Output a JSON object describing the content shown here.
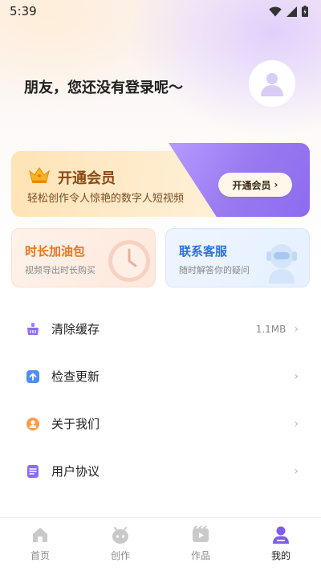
{
  "status_bar": {
    "time": "5:39"
  },
  "profile": {
    "greeting": "朋友，您还没有登录呢～"
  },
  "vip_card": {
    "title": "开通会员",
    "subtitle": "轻松创作令人惊艳的数字人短视频",
    "button_label": "开通会员",
    "button_chevron": "›"
  },
  "mini_cards": {
    "duration": {
      "title": "时长加油包",
      "subtitle": "视频导出时长购买"
    },
    "support": {
      "title": "联系客服",
      "subtitle": "随时解答你的疑问"
    }
  },
  "menu": {
    "items": [
      {
        "label": "清除缓存",
        "value": "1.1MB",
        "icon": "broom-icon"
      },
      {
        "label": "检查更新",
        "value": "",
        "icon": "update-icon"
      },
      {
        "label": "关于我们",
        "value": "",
        "icon": "about-icon"
      },
      {
        "label": "用户协议",
        "value": "",
        "icon": "agreement-icon"
      }
    ],
    "chevron": "›"
  },
  "tab_bar": {
    "tabs": [
      {
        "label": "首页",
        "icon": "home-icon",
        "active": false
      },
      {
        "label": "创作",
        "icon": "create-icon",
        "active": false
      },
      {
        "label": "作品",
        "icon": "works-icon",
        "active": false
      },
      {
        "label": "我的",
        "icon": "profile-icon",
        "active": true
      }
    ]
  },
  "colors": {
    "accent": "#7f5cf0",
    "vip_gold": "#8a4a14",
    "duration_orange": "#e6761f",
    "support_blue": "#2f6fe0"
  }
}
